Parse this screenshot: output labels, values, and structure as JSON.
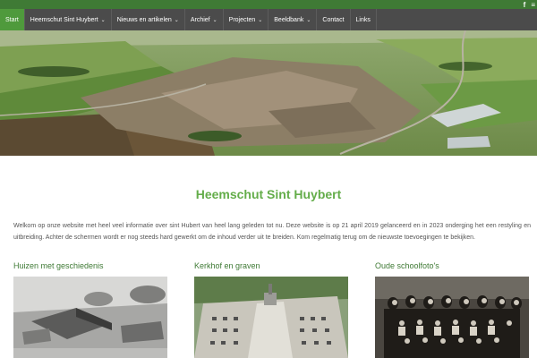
{
  "topbar": {
    "social": [
      {
        "icon": "facebook-icon",
        "label": "f"
      },
      {
        "icon": "more-icon",
        "label": "≡"
      }
    ]
  },
  "nav": {
    "items": [
      {
        "label": "Start",
        "active": true,
        "dropdown": false
      },
      {
        "label": "Heemschut Sint Huybert",
        "dropdown": true
      },
      {
        "label": "Nieuws en artikelen",
        "dropdown": true
      },
      {
        "label": "Archief",
        "dropdown": true
      },
      {
        "label": "Projecten",
        "dropdown": true
      },
      {
        "label": "Beeldbank",
        "dropdown": true
      },
      {
        "label": "Contact",
        "dropdown": false
      },
      {
        "label": "Links",
        "dropdown": false
      }
    ],
    "chevron": "⌄"
  },
  "main": {
    "title": "Heemschut Sint Huybert",
    "intro": "Welkom op onze website met heel veel informatie over sint Hubert van heel lang geleden tot nu. Deze website is op 21 april 2019 gelanceerd en in 2023 onderging het een restyling en uitbreiding. Achter de schermen wordt er nog steeds hard gewerkt om de inhoud verder uit te breiden. Kom regelmatig terug om de nieuwste toevoegingen te bekijken."
  },
  "cards": [
    {
      "title": "Huizen met geschiedenis"
    },
    {
      "title": "Kerkhof en graven"
    },
    {
      "title": "Oude schoolfoto's"
    }
  ],
  "colors": {
    "brand_green": "#4f9a3c",
    "topbar_green": "#3f7a35",
    "nav_bg": "#4b4b4b",
    "title_green": "#64ad4a"
  }
}
